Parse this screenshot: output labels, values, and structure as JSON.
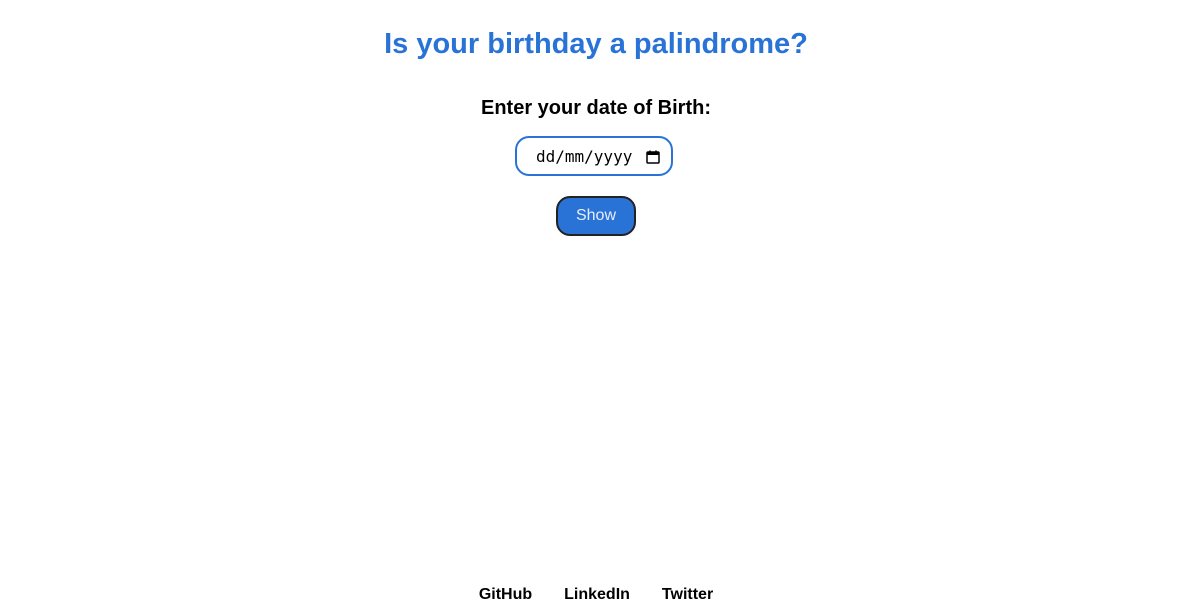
{
  "header": {
    "title": "Is your birthday a palindrome?"
  },
  "form": {
    "dob_label": "Enter your date of Birth:",
    "date_placeholder": "dd/mm/yyyy",
    "show_label": "Show"
  },
  "footer": {
    "links": [
      "GitHub",
      "LinkedIn",
      "Twitter"
    ]
  },
  "colors": {
    "accent": "#2a73d6",
    "text": "#000000",
    "background": "#ffffff"
  },
  "icons": {
    "date_picker": "calendar-icon"
  }
}
